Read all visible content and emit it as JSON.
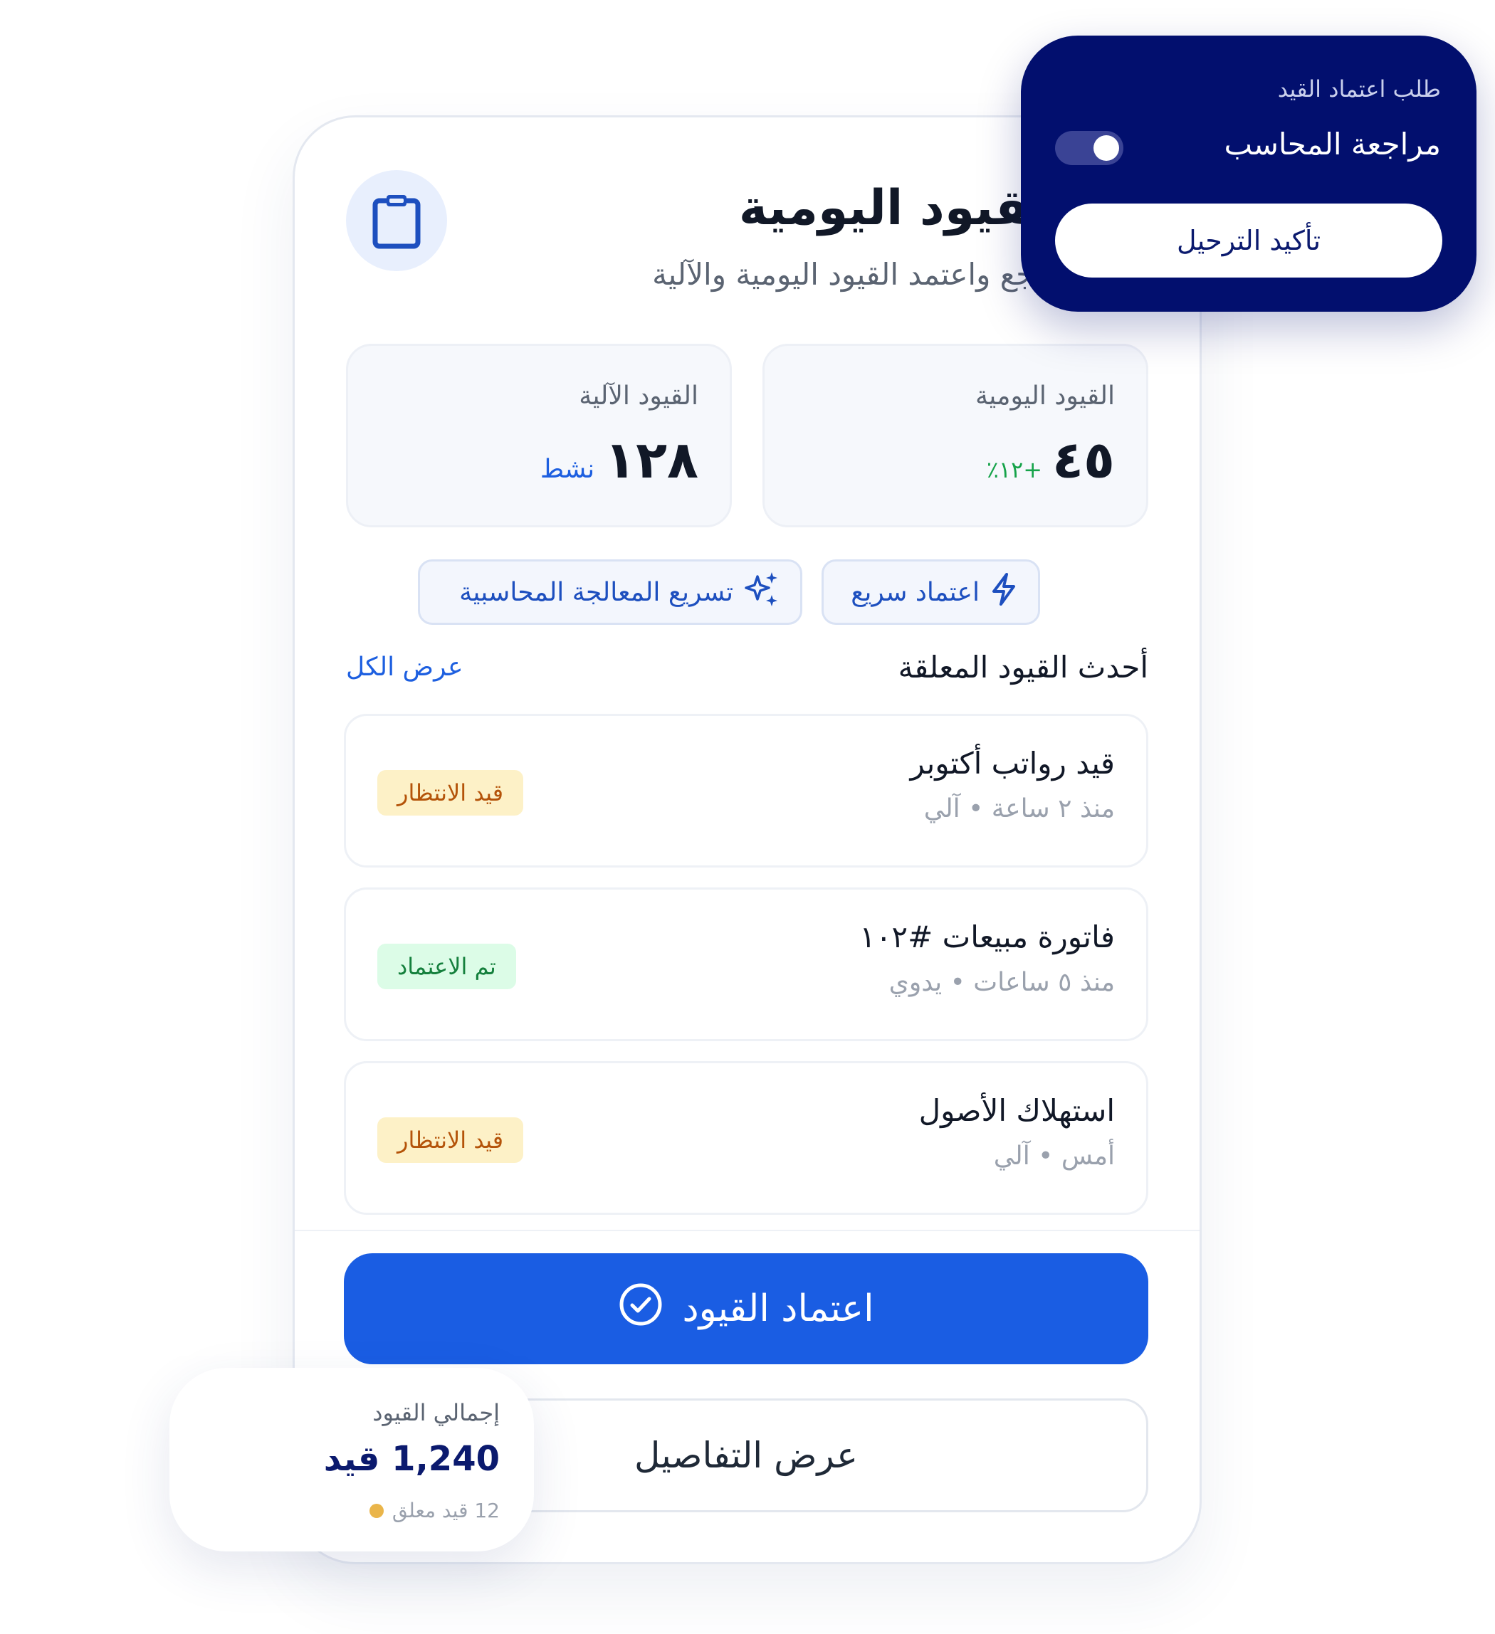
{
  "header": {
    "title": "القيود اليومية",
    "subtitle": "راجع واعتمد القيود اليومية والآلية",
    "icon": "clipboard-icon"
  },
  "stats": [
    {
      "label": "القيود اليومية",
      "value": "٤٥",
      "delta": "+١٢٪"
    },
    {
      "label": "القيود الآلية",
      "value": "١٢٨",
      "unit": "نشط"
    }
  ],
  "actions": {
    "quick_approve": "اعتماد سريع",
    "accelerate": "تسريع المعالجة المحاسبية"
  },
  "pending_section": {
    "title": "أحدث القيود المعلقة",
    "view_all": "عرض الكل",
    "entries": [
      {
        "title": "قيد رواتب أكتوبر",
        "meta": "منذ ٢ ساعة • آلي",
        "status": "قيد الانتظار",
        "status_type": "pending"
      },
      {
        "title": "فاتورة مبيعات #١٠٢",
        "meta": "منذ ٥ ساعات • يدوي",
        "status": "تم الاعتماد",
        "status_type": "approved"
      },
      {
        "title": "استهلاك الأصول",
        "meta": "أمس • آلي",
        "status": "قيد الانتظار",
        "status_type": "pending"
      }
    ]
  },
  "buttons": {
    "approve": "اعتماد القيود",
    "details": "عرض التفاصيل"
  },
  "popover": {
    "label": "طلب اعتماد القيد",
    "toggle_label": "مراجعة المحاسب",
    "toggle_on": true,
    "confirm": "تأكيد الترحيل"
  },
  "total": {
    "label": "إجمالي القيود",
    "value": "1,240 قيد",
    "note": "12 قيد معلق"
  },
  "colors": {
    "primary": "#1a5de3",
    "navy": "#020f6e",
    "pending_bg": "#fdf1c7",
    "pending_text": "#b45309",
    "approved_bg": "#dcfce7",
    "approved_text": "#15803d",
    "delta": "#16a34a"
  }
}
